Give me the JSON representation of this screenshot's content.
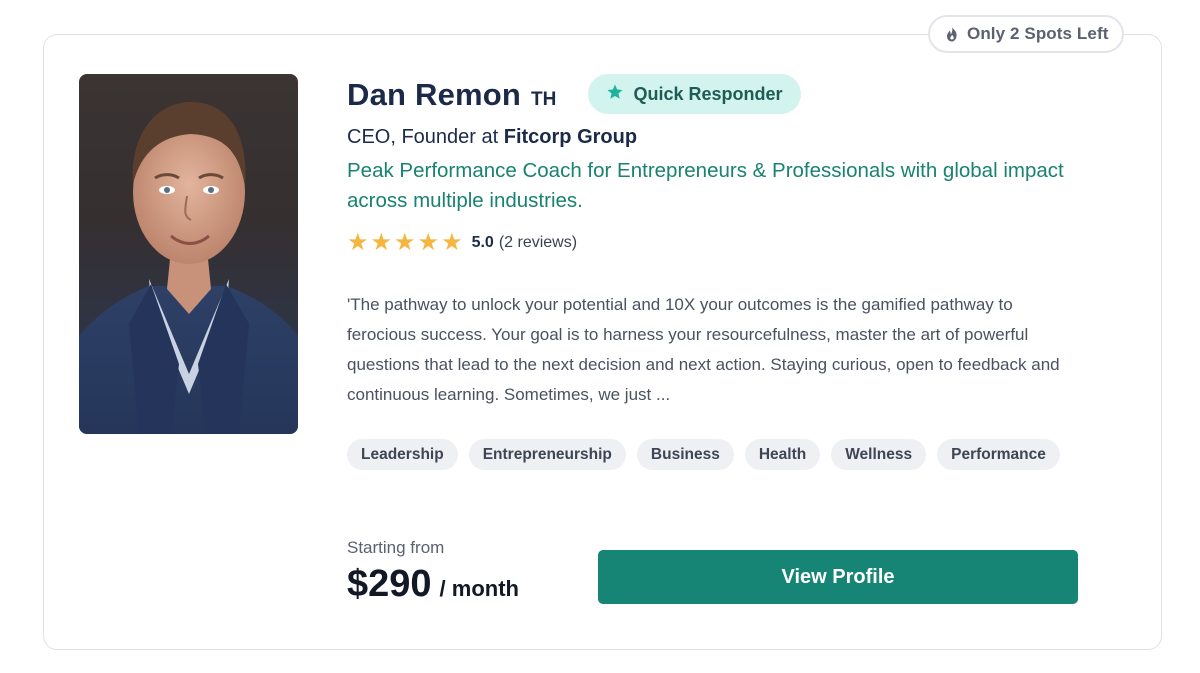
{
  "badge": {
    "spots_left": "Only 2 Spots Left",
    "icon": "flame-icon"
  },
  "coach": {
    "name": "Dan Remon",
    "country": "TH",
    "quick_responder": "Quick Responder",
    "role": "CEO, Founder at ",
    "company": "Fitcorp Group",
    "tagline": "Peak Performance Coach for Entrepreneurs & Professionals with global impact across multiple industries.",
    "rating": {
      "stars": 5,
      "score": "5.0",
      "reviews": "(2 reviews)"
    },
    "bio": "'The pathway to unlock your potential and 10X your outcomes is the gamified pathway to ferocious success. Your goal is to harness your resourcefulness, master the art of powerful questions that lead to the next decision and next action. Staying curious, open to feedback and continuous learning. Sometimes, we just ...",
    "tags": [
      "Leadership",
      "Entrepreneurship",
      "Business",
      "Health",
      "Wellness",
      "Performance"
    ]
  },
  "pricing": {
    "label": "Starting from",
    "amount": "$290",
    "period": "/ month"
  },
  "cta": {
    "label": "View Profile"
  },
  "colors": {
    "accent": "#168576",
    "tagline": "#198270",
    "badge_bg": "#d3f3ee",
    "star": "#f4b63f",
    "name": "#1c2a4a"
  }
}
